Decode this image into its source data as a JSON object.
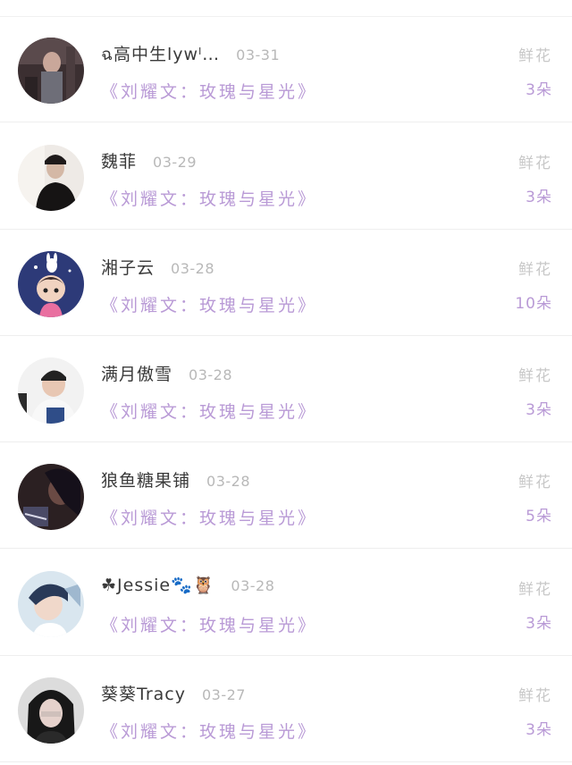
{
  "entries": [
    {
      "name": "ฉ高中生lywˡ…",
      "date": "03-31",
      "book": "《刘耀文：玫瑰与星光》",
      "gift": "鲜花",
      "count": "3朵"
    },
    {
      "name": "魏菲",
      "date": "03-29",
      "book": "《刘耀文：玫瑰与星光》",
      "gift": "鲜花",
      "count": "3朵"
    },
    {
      "name": "湘子云",
      "date": "03-28",
      "book": "《刘耀文：玫瑰与星光》",
      "gift": "鲜花",
      "count": "10朵"
    },
    {
      "name": "满月傲雪",
      "date": "03-28",
      "book": "《刘耀文：玫瑰与星光》",
      "gift": "鲜花",
      "count": "3朵"
    },
    {
      "name": "狼鱼糖果铺",
      "date": "03-28",
      "book": "《刘耀文：玫瑰与星光》",
      "gift": "鲜花",
      "count": "5朵"
    },
    {
      "name": "☘Jessie🐾🦉",
      "date": "03-28",
      "book": "《刘耀文：玫瑰与星光》",
      "gift": "鲜花",
      "count": "3朵"
    },
    {
      "name": "葵葵Tracy",
      "date": "03-27",
      "book": "《刘耀文：玫瑰与星光》",
      "gift": "鲜花",
      "count": "3朵"
    }
  ],
  "colors": {
    "book": "#b99ad6",
    "count": "#b99ad6",
    "gift": "#c8c8c8",
    "date": "#b8b8b8",
    "name": "#3a3a3a"
  }
}
